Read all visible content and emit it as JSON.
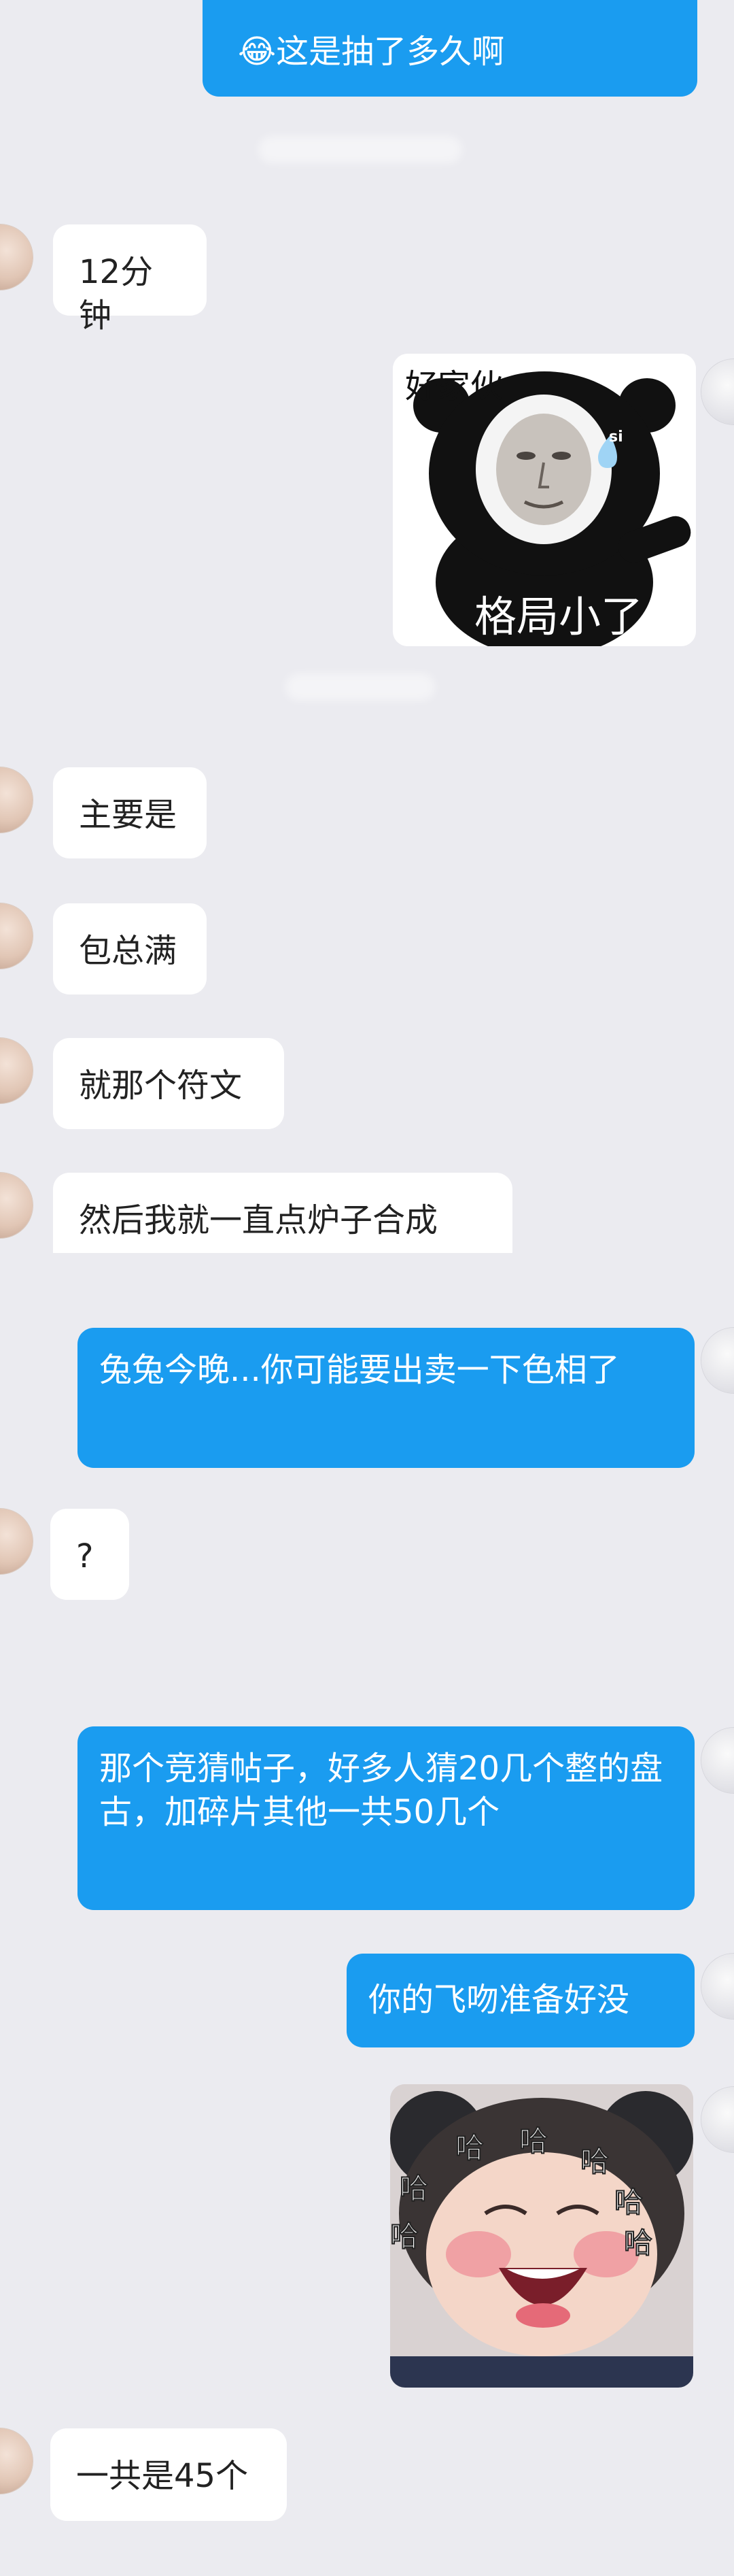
{
  "messages": [
    {
      "id": "m1",
      "side": "out",
      "text": "😂这是抽了多久啊"
    },
    {
      "id": "m2",
      "side": "in",
      "text": "12分钟"
    },
    {
      "id": "m3",
      "side": "out",
      "type": "sticker",
      "sticker": "panda-meme",
      "caption_top": "好家伙",
      "caption_bottom": "格局小了",
      "tear": "si"
    },
    {
      "id": "m4",
      "side": "in",
      "text": "主要是"
    },
    {
      "id": "m5",
      "side": "in",
      "text": "包总满"
    },
    {
      "id": "m6",
      "side": "in",
      "text": "就那个符文"
    },
    {
      "id": "m7",
      "side": "in",
      "text": "然后我就一直点炉子合成"
    },
    {
      "id": "m8",
      "side": "out",
      "text": "兔兔今晚...你可能要出卖一下色相了"
    },
    {
      "id": "m9",
      "side": "in",
      "text": "?"
    },
    {
      "id": "m10",
      "side": "out",
      "text": "那个竞猜帖子，好多人猜20几个整的盘古，加碎片其他一共50几个"
    },
    {
      "id": "m11",
      "side": "out",
      "text": "你的飞吻准备好没"
    },
    {
      "id": "m12",
      "side": "out",
      "type": "sticker",
      "sticker": "laughing-baby",
      "caption": "哈"
    },
    {
      "id": "m13",
      "side": "in",
      "text": "一共是45个"
    }
  ],
  "colors": {
    "outgoing": "#1a9cf0",
    "incoming": "#ffffff",
    "background": "#ebebf0"
  }
}
